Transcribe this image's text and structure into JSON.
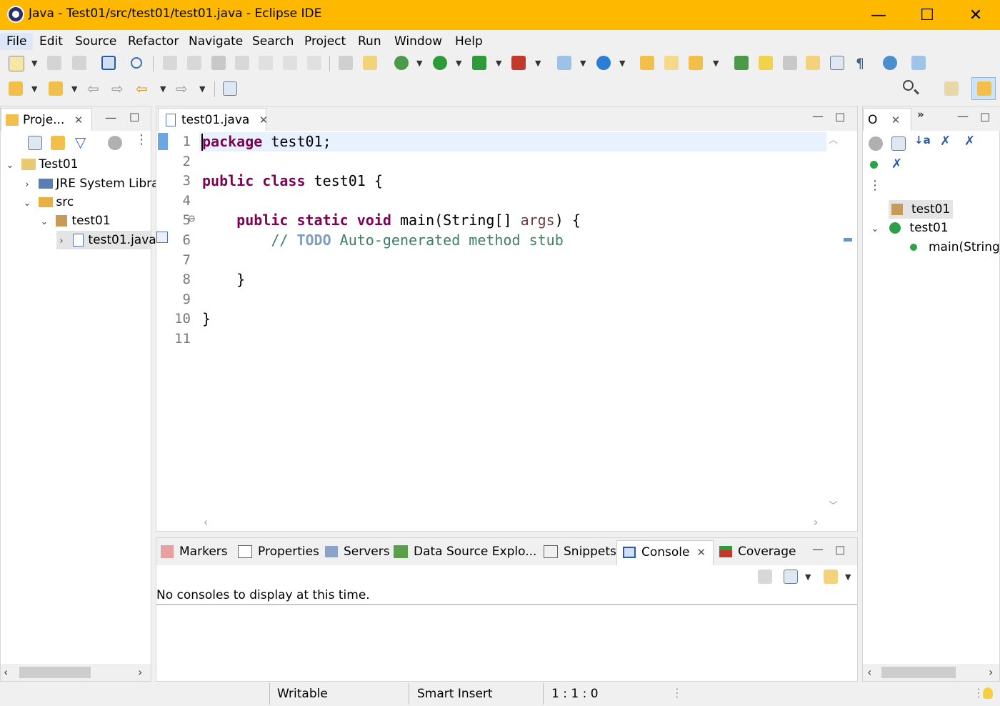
{
  "window": {
    "title": "Java - Test01/src/test01/test01.java - Eclipse IDE",
    "minimize": "—",
    "maximize": "☐",
    "close": "✕"
  },
  "menu": [
    "File",
    "Edit",
    "Source",
    "Refactor",
    "Navigate",
    "Search",
    "Project",
    "Run",
    "Window",
    "Help"
  ],
  "project_explorer": {
    "tab_label": "Proje...",
    "tree": [
      {
        "label": "Test01",
        "chevron": "⌄"
      },
      {
        "label": "JRE System Libra",
        "chevron": "›"
      },
      {
        "label": "src",
        "chevron": "⌄"
      },
      {
        "label": "test01",
        "chevron": "⌄"
      },
      {
        "label": "test01.java",
        "chevron": "›"
      }
    ]
  },
  "editor": {
    "tab_label": "test01.java",
    "line_numbers": [
      "1",
      "2",
      "3",
      "4",
      "5",
      "6",
      "7",
      "8",
      "9",
      "10",
      "11"
    ],
    "code": {
      "l1_kw": "package",
      "l1_rest": " test01;",
      "l3_kw1": "public",
      "l3_kw2": "class",
      "l3_rest": " test01 {",
      "l5_kw1": "public",
      "l5_kw2": "static",
      "l5_kw3": "void",
      "l5_mid": " main(String[] ",
      "l5_param": "args",
      "l5_end": ") {",
      "l6_cm1": "// ",
      "l6_todo": "TODO",
      "l6_cm2": " Auto-generated method stub",
      "l8": "}",
      "l10": "}"
    }
  },
  "outline": {
    "tab_label": "O",
    "tree": [
      {
        "label": "test01"
      },
      {
        "label": "test01",
        "chevron": "⌄"
      },
      {
        "label": "main(String"
      }
    ]
  },
  "bottom_tabs": [
    "Markers",
    "Properties",
    "Servers",
    "Data Source Explo...",
    "Snippets",
    "Console",
    "Coverage"
  ],
  "console": {
    "message": "No consoles to display at this time."
  },
  "status": {
    "writable": "Writable",
    "insert_mode": "Smart Insert",
    "position": "1 : 1 : 0"
  },
  "colors": {
    "titlebar": "#ffb800",
    "keyword": "#7f0055",
    "comment": "#3f7f5f",
    "todo": "#7f9fbf"
  }
}
